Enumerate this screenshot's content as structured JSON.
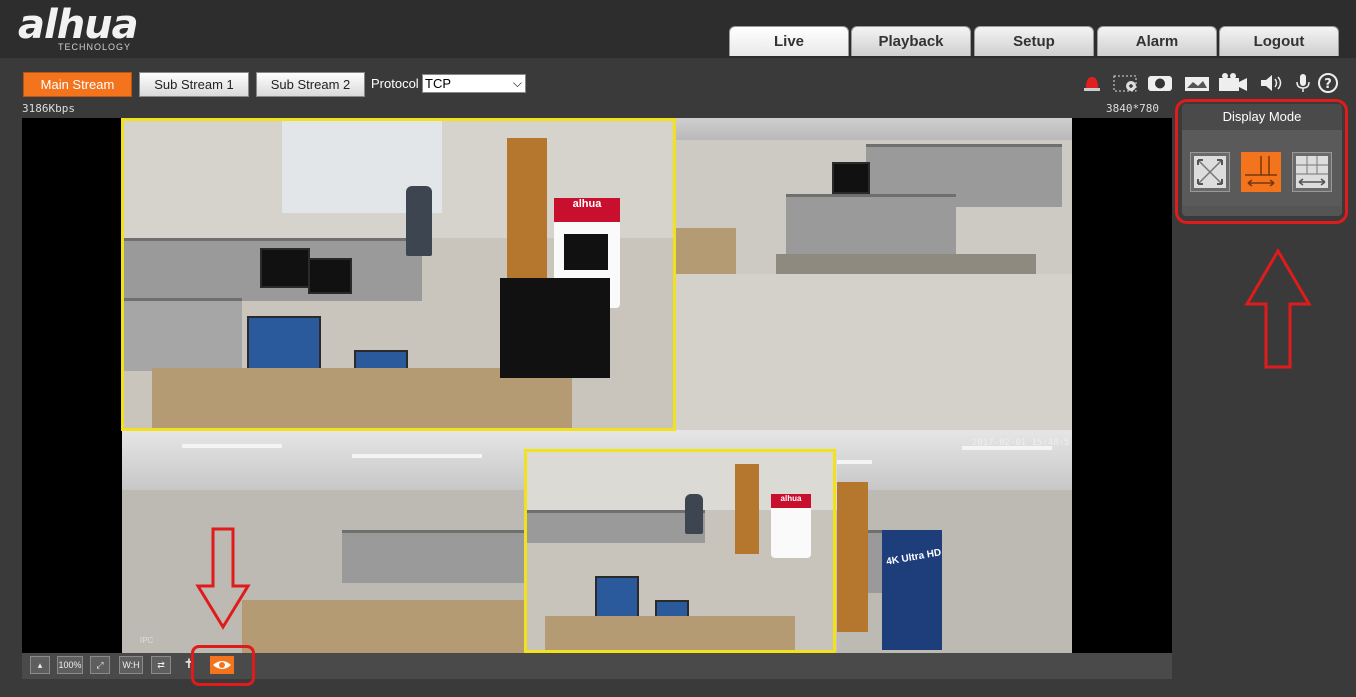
{
  "brand": {
    "name": "alhua",
    "sub": "TECHNOLOGY"
  },
  "nav": {
    "tabs": [
      "Live",
      "Playback",
      "Setup",
      "Alarm",
      "Logout"
    ],
    "active": "Live"
  },
  "streams": {
    "main": "Main Stream",
    "sub1": "Sub Stream 1",
    "sub2": "Sub Stream 2",
    "active": "Main Stream"
  },
  "protocol": {
    "label": "Protocol",
    "value": "TCP"
  },
  "stats": {
    "bitrate": "3186Kbps",
    "resolution": "3840*780"
  },
  "toolbar_icons": [
    "alarm-siren-icon",
    "zoom-region-icon",
    "snapshot-icon",
    "triple-snapshot-icon",
    "record-icon",
    "audio-icon",
    "microphone-icon",
    "help-icon"
  ],
  "display_mode": {
    "title": "Display Mode",
    "modes": [
      "original-view",
      "split-1p3-view",
      "panorama-grid-view"
    ],
    "active": "split-1p3-view"
  },
  "bottom_toolbar": {
    "buttons": [
      "ptz-icon",
      "100%",
      "fullscreen-icon",
      "W:H",
      "fit-icon",
      "crosshair-icon",
      "eye-icon"
    ],
    "labels": {
      "zoom": "100%",
      "ratio": "W:H"
    },
    "active": "eye-icon"
  },
  "osd": {
    "time": "2017-02-01 15:48:5",
    "camera": "IPC"
  },
  "colors": {
    "accent": "#f3741d",
    "highlight_frame": "#f2e21b",
    "annotation": "#e01b1b",
    "brand_red": "#c8102e"
  }
}
